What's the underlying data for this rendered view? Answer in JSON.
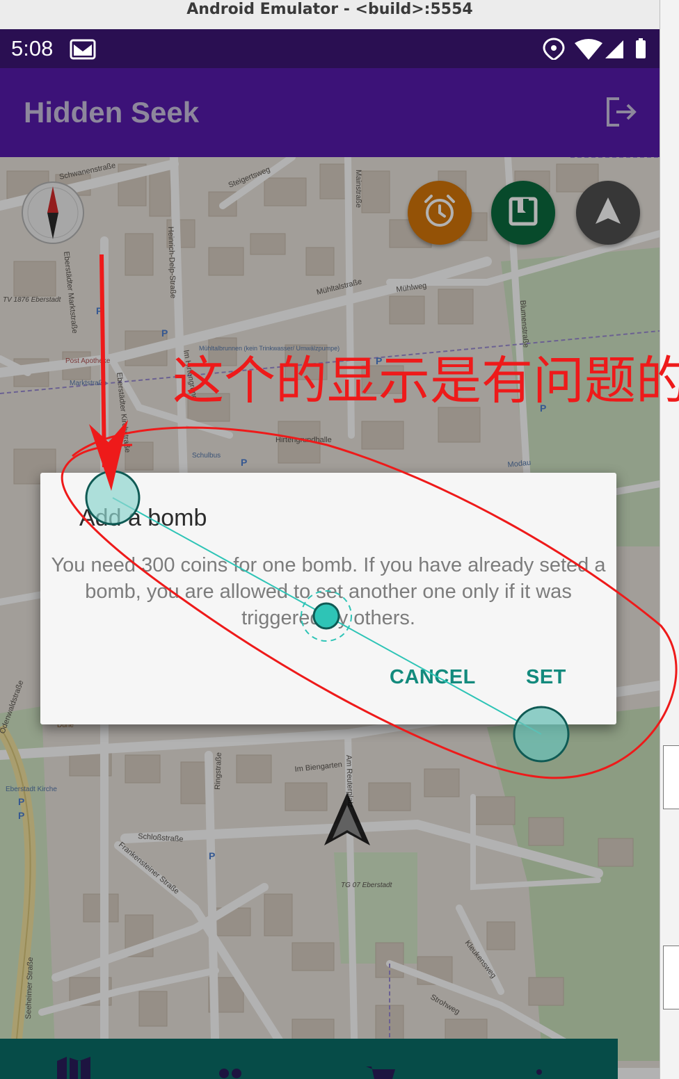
{
  "window": {
    "title": "Android Emulator - <build>:5554"
  },
  "status_bar": {
    "time": "5:08"
  },
  "app_bar": {
    "title": "Hidden Seek"
  },
  "map": {
    "street_labels": [
      "Schwanenstraße",
      "Steigertsweg",
      "Heinrich-Delp-Straße",
      "Mainstraße",
      "Mühltalstraße",
      "Mühlweg",
      "Blumenstraße",
      "Eberstädter Marktstraße",
      "Eberstädter Kirchstraße",
      "Im Hirtengrund",
      "Hirtengrundhalle",
      "Schulbus",
      "Post Apotheke",
      "Marktstraße",
      "TV 1876 Eberstadt",
      "Mühltalbrunnen (kein Trinkwasser/ Umwälzpumpe)",
      "Odenwaldstraße",
      "Im Biengarten",
      "Am Reuterplatz",
      "Ringstraße",
      "Schloßstraße",
      "Frankensteiner Straße",
      "Eberstadt Kirche",
      "Seeheimer Straße",
      "TG 07 Eberstadt",
      "Kleukensweg",
      "Strohweg",
      "Düne",
      "Modau"
    ]
  },
  "dialog": {
    "title": "Add a bomb",
    "message": "You need 300 coins for one bomb. If you have already seted a bomb, you are allowed to set another one only if it was triggered by others.",
    "cancel_label": "CANCEL",
    "set_label": "SET"
  },
  "annotation": {
    "text": "这个的显示是有问题的"
  },
  "colors": {
    "status_bar": "#2a0f52",
    "app_bar": "#3c1278",
    "dialog_button": "#138a7d",
    "timer_fab": "#d4760a",
    "book_fab": "#0b6b3e",
    "locate_fab": "#505050",
    "bottom_nav": "#0a6e67",
    "annotation_red": "#ee1a1a"
  },
  "icons": [
    "email-icon",
    "location-icon",
    "wifi-icon",
    "signal-icon",
    "battery-icon",
    "logout-icon",
    "compass-icon",
    "alarm-clock-icon",
    "book-icon",
    "navigation-arrow-icon",
    "user-location-arrow-icon",
    "map-icon",
    "people-icon",
    "cart-icon",
    "more-icon"
  ]
}
